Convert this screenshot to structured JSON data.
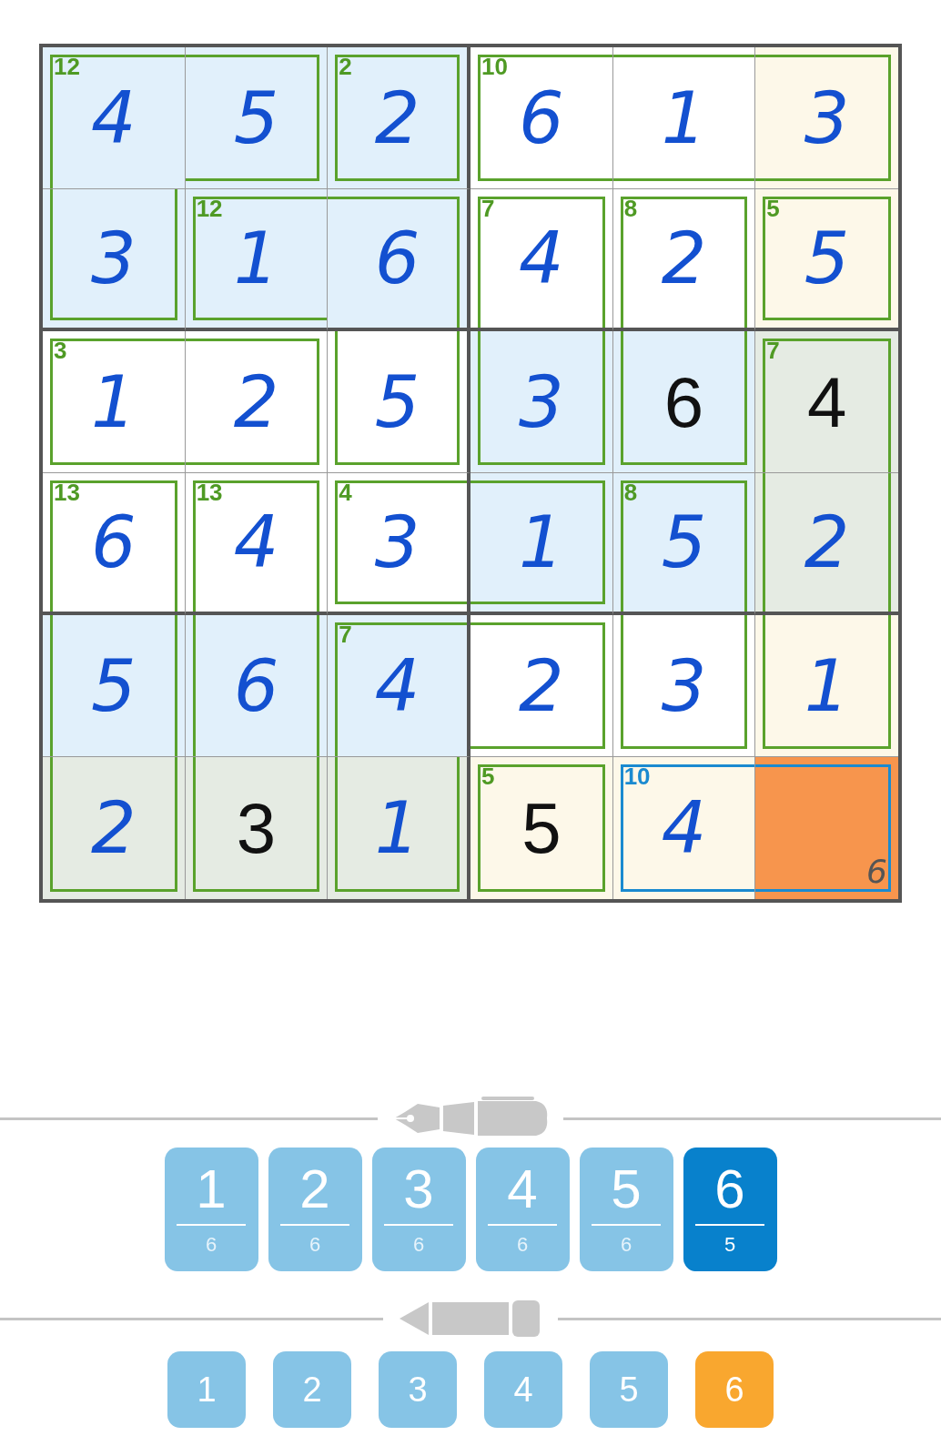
{
  "grid": {
    "rows": [
      {
        "cells": [
          {
            "value": "4",
            "given": false,
            "color": "#e1f0fb"
          },
          {
            "value": "5",
            "given": false,
            "color": "#e1f0fb"
          },
          {
            "value": "2",
            "given": false,
            "color": "#e1f0fb"
          },
          {
            "value": "6",
            "given": false,
            "color": "#ffffff"
          },
          {
            "value": "1",
            "given": false,
            "color": "#ffffff"
          },
          {
            "value": "3",
            "given": false,
            "color": "#fdf8e9"
          }
        ]
      },
      {
        "cells": [
          {
            "value": "3",
            "given": false,
            "color": "#e1f0fb"
          },
          {
            "value": "1",
            "given": false,
            "color": "#e1f0fb"
          },
          {
            "value": "6",
            "given": false,
            "color": "#e1f0fb"
          },
          {
            "value": "4",
            "given": false,
            "color": "#ffffff"
          },
          {
            "value": "2",
            "given": false,
            "color": "#ffffff"
          },
          {
            "value": "5",
            "given": false,
            "color": "#fdf8e9"
          }
        ]
      },
      {
        "cells": [
          {
            "value": "1",
            "given": false,
            "color": "#ffffff"
          },
          {
            "value": "2",
            "given": false,
            "color": "#ffffff"
          },
          {
            "value": "5",
            "given": false,
            "color": "#ffffff"
          },
          {
            "value": "3",
            "given": false,
            "color": "#e1f0fb"
          },
          {
            "value": "6",
            "given": true,
            "color": "#e1f0fb"
          },
          {
            "value": "4",
            "given": true,
            "color": "#e5ebe3"
          }
        ]
      },
      {
        "cells": [
          {
            "value": "6",
            "given": false,
            "color": "#ffffff"
          },
          {
            "value": "4",
            "given": false,
            "color": "#ffffff"
          },
          {
            "value": "3",
            "given": false,
            "color": "#ffffff"
          },
          {
            "value": "1",
            "given": false,
            "color": "#e1f0fb"
          },
          {
            "value": "5",
            "given": false,
            "color": "#e1f0fb"
          },
          {
            "value": "2",
            "given": false,
            "color": "#e5ebe3"
          }
        ]
      },
      {
        "cells": [
          {
            "value": "5",
            "given": false,
            "color": "#e1f0fb"
          },
          {
            "value": "6",
            "given": false,
            "color": "#e1f0fb"
          },
          {
            "value": "4",
            "given": false,
            "color": "#e1f0fb"
          },
          {
            "value": "2",
            "given": false,
            "color": "#ffffff"
          },
          {
            "value": "3",
            "given": false,
            "color": "#ffffff"
          },
          {
            "value": "1",
            "given": false,
            "color": "#fdf8e9"
          }
        ]
      },
      {
        "cells": [
          {
            "value": "2",
            "given": false,
            "color": "#e5ebe3"
          },
          {
            "value": "3",
            "given": true,
            "color": "#e5ebe3"
          },
          {
            "value": "1",
            "given": false,
            "color": "#e5ebe3"
          },
          {
            "value": "5",
            "given": true,
            "color": "#fdf8e9"
          },
          {
            "value": "4",
            "given": false,
            "color": "#fdf8e9"
          },
          {
            "pencil": "6",
            "color": "#f7954d"
          }
        ]
      }
    ]
  },
  "cages": [
    {
      "sum": "12",
      "selected": false
    },
    {
      "sum": "2",
      "selected": false
    },
    {
      "sum": "10",
      "selected": false
    },
    {
      "sum": "12",
      "selected": false
    },
    {
      "sum": "7",
      "selected": false
    },
    {
      "sum": "8",
      "selected": false
    },
    {
      "sum": "5",
      "selected": false
    },
    {
      "sum": "3",
      "selected": false
    },
    {
      "sum": "7",
      "selected": false
    },
    {
      "sum": "13",
      "selected": false
    },
    {
      "sum": "13",
      "selected": false
    },
    {
      "sum": "4",
      "selected": false
    },
    {
      "sum": "8",
      "selected": false
    },
    {
      "sum": "7",
      "selected": false
    },
    {
      "sum": "5",
      "selected": false
    },
    {
      "sum": "10",
      "selected": true
    }
  ],
  "pen_keys": [
    {
      "digit": "1",
      "count": "6",
      "selected": false
    },
    {
      "digit": "2",
      "count": "6",
      "selected": false
    },
    {
      "digit": "3",
      "count": "6",
      "selected": false
    },
    {
      "digit": "4",
      "count": "6",
      "selected": false
    },
    {
      "digit": "5",
      "count": "6",
      "selected": false
    },
    {
      "digit": "6",
      "count": "5",
      "selected": true
    }
  ],
  "pencil_keys": [
    {
      "digit": "1",
      "selected": false
    },
    {
      "digit": "2",
      "selected": false
    },
    {
      "digit": "3",
      "selected": false
    },
    {
      "digit": "4",
      "selected": false
    },
    {
      "digit": "5",
      "selected": false
    },
    {
      "digit": "6",
      "selected": true
    }
  ]
}
